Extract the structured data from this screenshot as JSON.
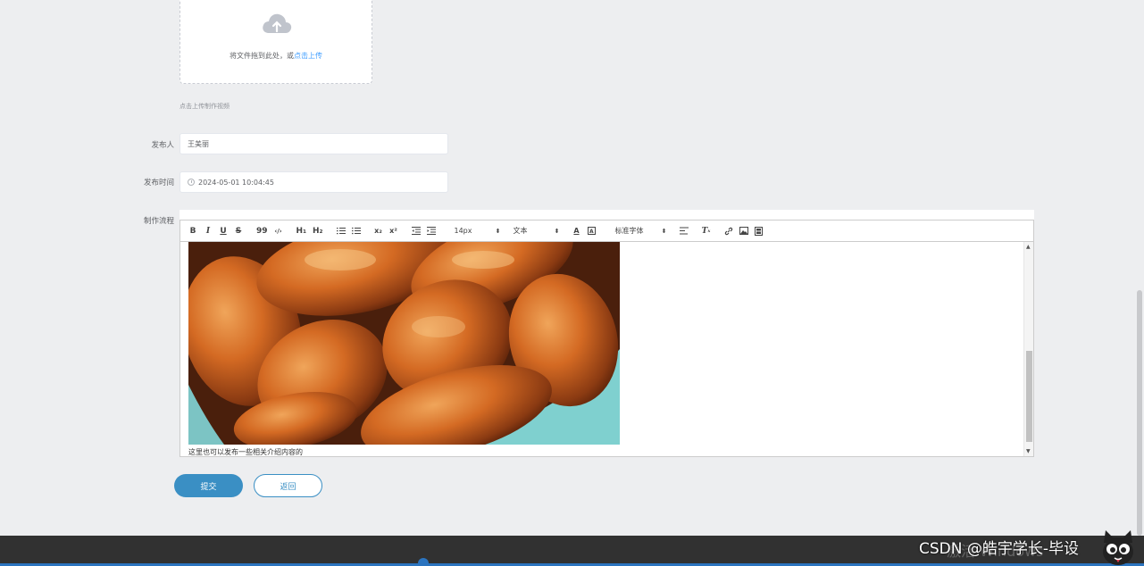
{
  "form": {
    "upload": {
      "hint_text": "将文件拖到此处，或",
      "link_text": "点击上传",
      "sub_hint": "点击上传制作视频"
    },
    "publisher": {
      "label": "发布人",
      "value": "王美丽"
    },
    "publish_time": {
      "label": "发布时间",
      "value": "2024-05-01 10:04:45"
    },
    "process": {
      "label": "制作流程"
    }
  },
  "editor": {
    "toolbar": {
      "bold": "B",
      "italic": "I",
      "underline": "U",
      "strike": "S",
      "quote": "99",
      "code": "‹/›",
      "h1": "H₁",
      "h2": "H₂",
      "sub": "x₂",
      "sup": "x²",
      "size": "14px",
      "block": "文本",
      "font": "标准字体"
    },
    "content_text": "这里也可以发布一些相关介绍内容的"
  },
  "buttons": {
    "submit": "提交",
    "back": "返回"
  },
  "overlay": {
    "watermark": "激活 Windows",
    "csdn": "CSDN @皓宇学长-毕设"
  }
}
